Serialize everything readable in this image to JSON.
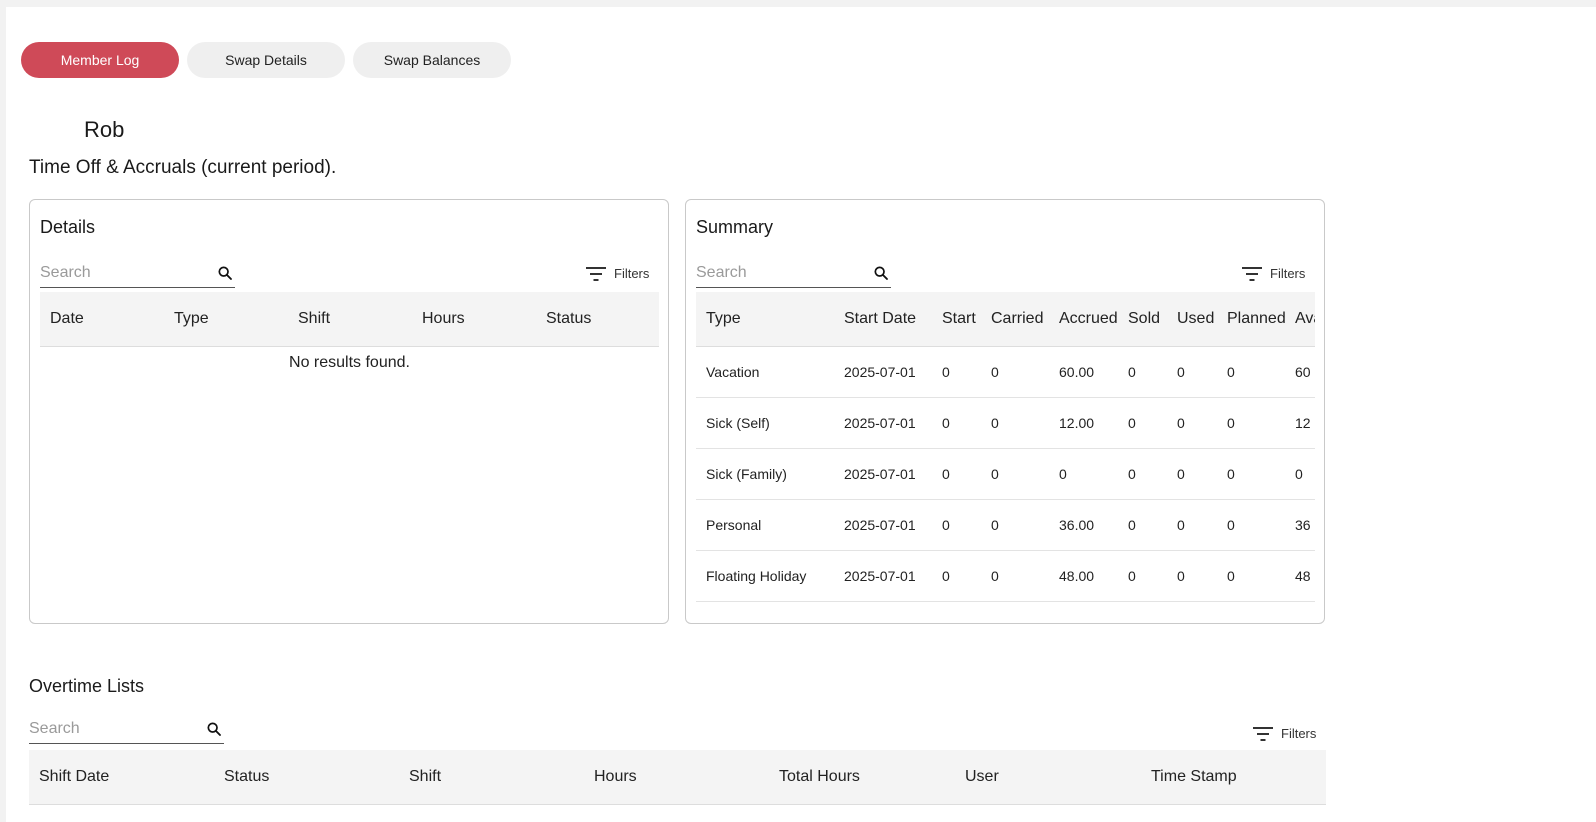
{
  "tabs": [
    {
      "label": "Member Log",
      "active": true
    },
    {
      "label": "Swap Details",
      "active": false
    },
    {
      "label": "Swap Balances",
      "active": false
    }
  ],
  "user": {
    "name": "Rob"
  },
  "section_title": "Time Off & Accruals (current period).",
  "details": {
    "title": "Details",
    "search_placeholder": "Search",
    "filters_label": "Filters",
    "columns": [
      "Date",
      "Type",
      "Shift",
      "Hours",
      "Status"
    ],
    "empty_message": "No results found."
  },
  "summary": {
    "title": "Summary",
    "search_placeholder": "Search",
    "filters_label": "Filters",
    "columns": [
      "Type",
      "Start Date",
      "Start",
      "Carried",
      "Accrued",
      "Sold",
      "Used",
      "Planned",
      "Available"
    ],
    "rows": [
      [
        "Vacation",
        "2025-07-01",
        "0",
        "0",
        "60.00",
        "0",
        "0",
        "0",
        "60"
      ],
      [
        "Sick (Self)",
        "2025-07-01",
        "0",
        "0",
        "12.00",
        "0",
        "0",
        "0",
        "12"
      ],
      [
        "Sick (Family)",
        "2025-07-01",
        "0",
        "0",
        "0",
        "0",
        "0",
        "0",
        "0"
      ],
      [
        "Personal",
        "2025-07-01",
        "0",
        "0",
        "36.00",
        "0",
        "0",
        "0",
        "36"
      ],
      [
        "Floating Holiday",
        "2025-07-01",
        "0",
        "0",
        "48.00",
        "0",
        "0",
        "0",
        "48"
      ]
    ]
  },
  "overtime": {
    "title": "Overtime Lists",
    "search_placeholder": "Search",
    "filters_label": "Filters",
    "columns": [
      "Shift Date",
      "Status",
      "Shift",
      "Hours",
      "Total Hours",
      "User",
      "Time Stamp"
    ]
  },
  "icons": {
    "search": "search-icon",
    "filter": "filter-list-icon"
  },
  "colors": {
    "accent": "#cf4a58",
    "tab_inactive": "#efefef",
    "header_bg": "#f4f4f4"
  }
}
